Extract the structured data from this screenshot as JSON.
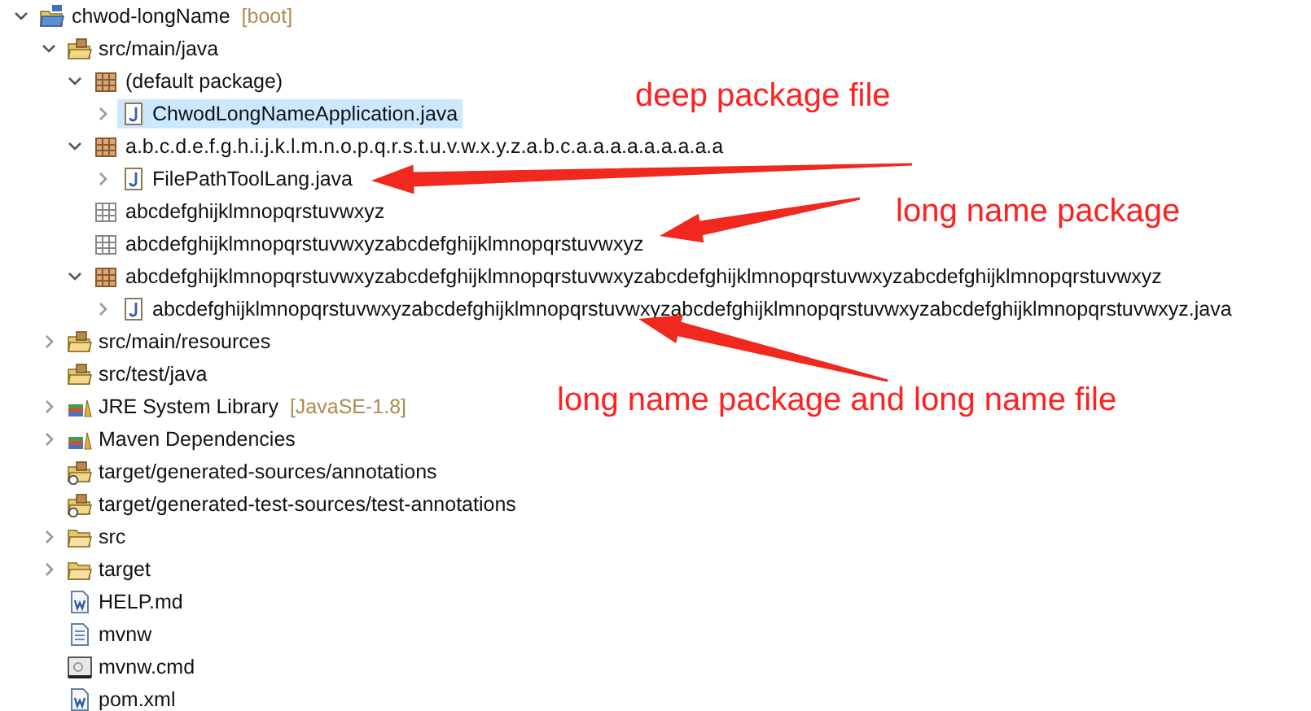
{
  "tree": [
    {
      "label": "chwod-longName",
      "decoration": "[boot]",
      "kind": "project",
      "expanded": true,
      "selected": false,
      "children": [
        {
          "label": "src/main/java",
          "kind": "source-folder",
          "expanded": true,
          "selected": false,
          "children": [
            {
              "label": "(default package)",
              "kind": "package",
              "expanded": true,
              "selected": false,
              "children": [
                {
                  "label": "ChwodLongNameApplication.java",
                  "kind": "java",
                  "expanded": false,
                  "selected": true
                }
              ]
            },
            {
              "label": "a.b.c.d.e.f.g.h.i.j.k.l.m.n.o.p.q.r.s.t.u.v.w.x.y.z.a.b.c.a.a.a.a.a.a.a.a.a",
              "kind": "package",
              "expanded": true,
              "selected": false,
              "children": [
                {
                  "label": "FilePathToolLang.java",
                  "kind": "java",
                  "expanded": false,
                  "selected": false
                }
              ]
            },
            {
              "label": "abcdefghijklmnopqrstuvwxyz",
              "kind": "empty-package",
              "selected": false
            },
            {
              "label": "abcdefghijklmnopqrstuvwxyzabcdefghijklmnopqrstuvwxyz",
              "kind": "empty-package",
              "selected": false
            },
            {
              "label": "abcdefghijklmnopqrstuvwxyzabcdefghijklmnopqrstuvwxyzabcdefghijklmnopqrstuvwxyzabcdefghijklmnopqrstuvwxyz",
              "kind": "package",
              "expanded": true,
              "selected": false,
              "children": [
                {
                  "label": "abcdefghijklmnopqrstuvwxyzabcdefghijklmnopqrstuvwxyzabcdefghijklmnopqrstuvwxyzabcdefghijklmnopqrstuvwxyz.java",
                  "kind": "java",
                  "expanded": false,
                  "selected": false
                }
              ]
            }
          ]
        },
        {
          "label": "src/main/resources",
          "kind": "source-folder",
          "expanded": false,
          "selected": false
        },
        {
          "label": "src/test/java",
          "kind": "source-folder",
          "selected": false
        },
        {
          "label": "JRE System Library",
          "decoration": "[JavaSE-1.8]",
          "kind": "library",
          "expanded": false,
          "selected": false
        },
        {
          "label": "Maven Dependencies",
          "kind": "library",
          "expanded": false,
          "selected": false
        },
        {
          "label": "target/generated-sources/annotations",
          "kind": "generated-folder",
          "selected": false
        },
        {
          "label": "target/generated-test-sources/test-annotations",
          "kind": "generated-folder",
          "selected": false
        },
        {
          "label": "src",
          "kind": "folder",
          "expanded": false,
          "selected": false
        },
        {
          "label": "target",
          "kind": "folder",
          "expanded": false,
          "selected": false
        },
        {
          "label": "HELP.md",
          "kind": "markdown-file",
          "selected": false
        },
        {
          "label": "mvnw",
          "kind": "text-file",
          "selected": false
        },
        {
          "label": "mvnw.cmd",
          "kind": "script-file",
          "selected": false
        },
        {
          "label": "pom.xml",
          "kind": "maven-file",
          "selected": false
        }
      ]
    }
  ],
  "annotations": [
    {
      "text": "deep package file"
    },
    {
      "text": "long name package"
    },
    {
      "text": "long name package and long name file"
    }
  ]
}
